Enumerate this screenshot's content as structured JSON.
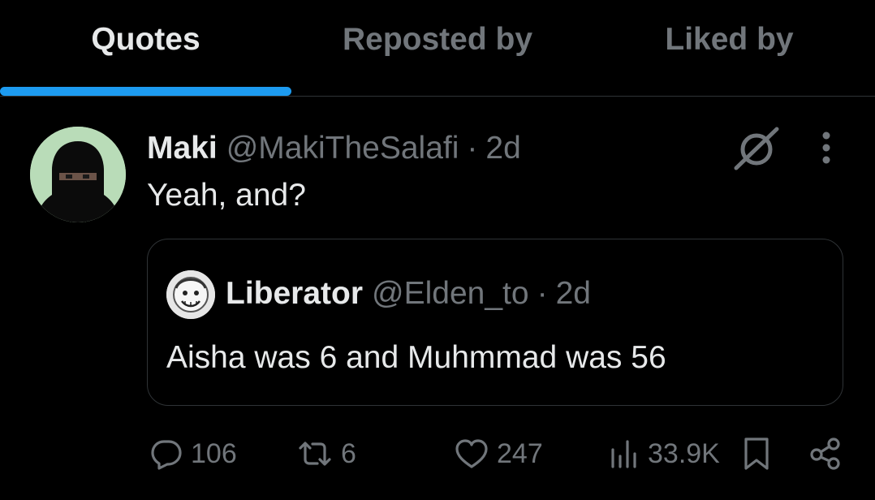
{
  "tabs": [
    {
      "label": "Quotes",
      "active": true
    },
    {
      "label": "Reposted by",
      "active": false
    },
    {
      "label": "Liked by",
      "active": false
    }
  ],
  "post": {
    "author_name": "Maki",
    "author_handle": "@MakiTheSalafi",
    "separator": "·",
    "time": "2d",
    "text": "Yeah, and?",
    "quote": {
      "author_name": "Liberator",
      "author_handle": "@Elden_to",
      "separator": "·",
      "time": "2d",
      "text": "Aisha was 6 and Muhmmad was 56"
    },
    "actions": {
      "replies": "106",
      "reposts": "6",
      "likes": "247",
      "views": "33.9K"
    }
  },
  "icons": {
    "grok": "grok-icon",
    "more": "more-icon",
    "reply": "reply-icon",
    "repost": "repost-icon",
    "like": "heart-icon",
    "views": "views-icon",
    "bookmark": "bookmark-icon",
    "share": "share-icon"
  },
  "colors": {
    "background": "#000000",
    "accent": "#1d9bf0",
    "text_primary": "#e7e9ea",
    "text_secondary": "#71767b",
    "border": "#2f3336",
    "avatar_bg": "#b9dcb8"
  }
}
